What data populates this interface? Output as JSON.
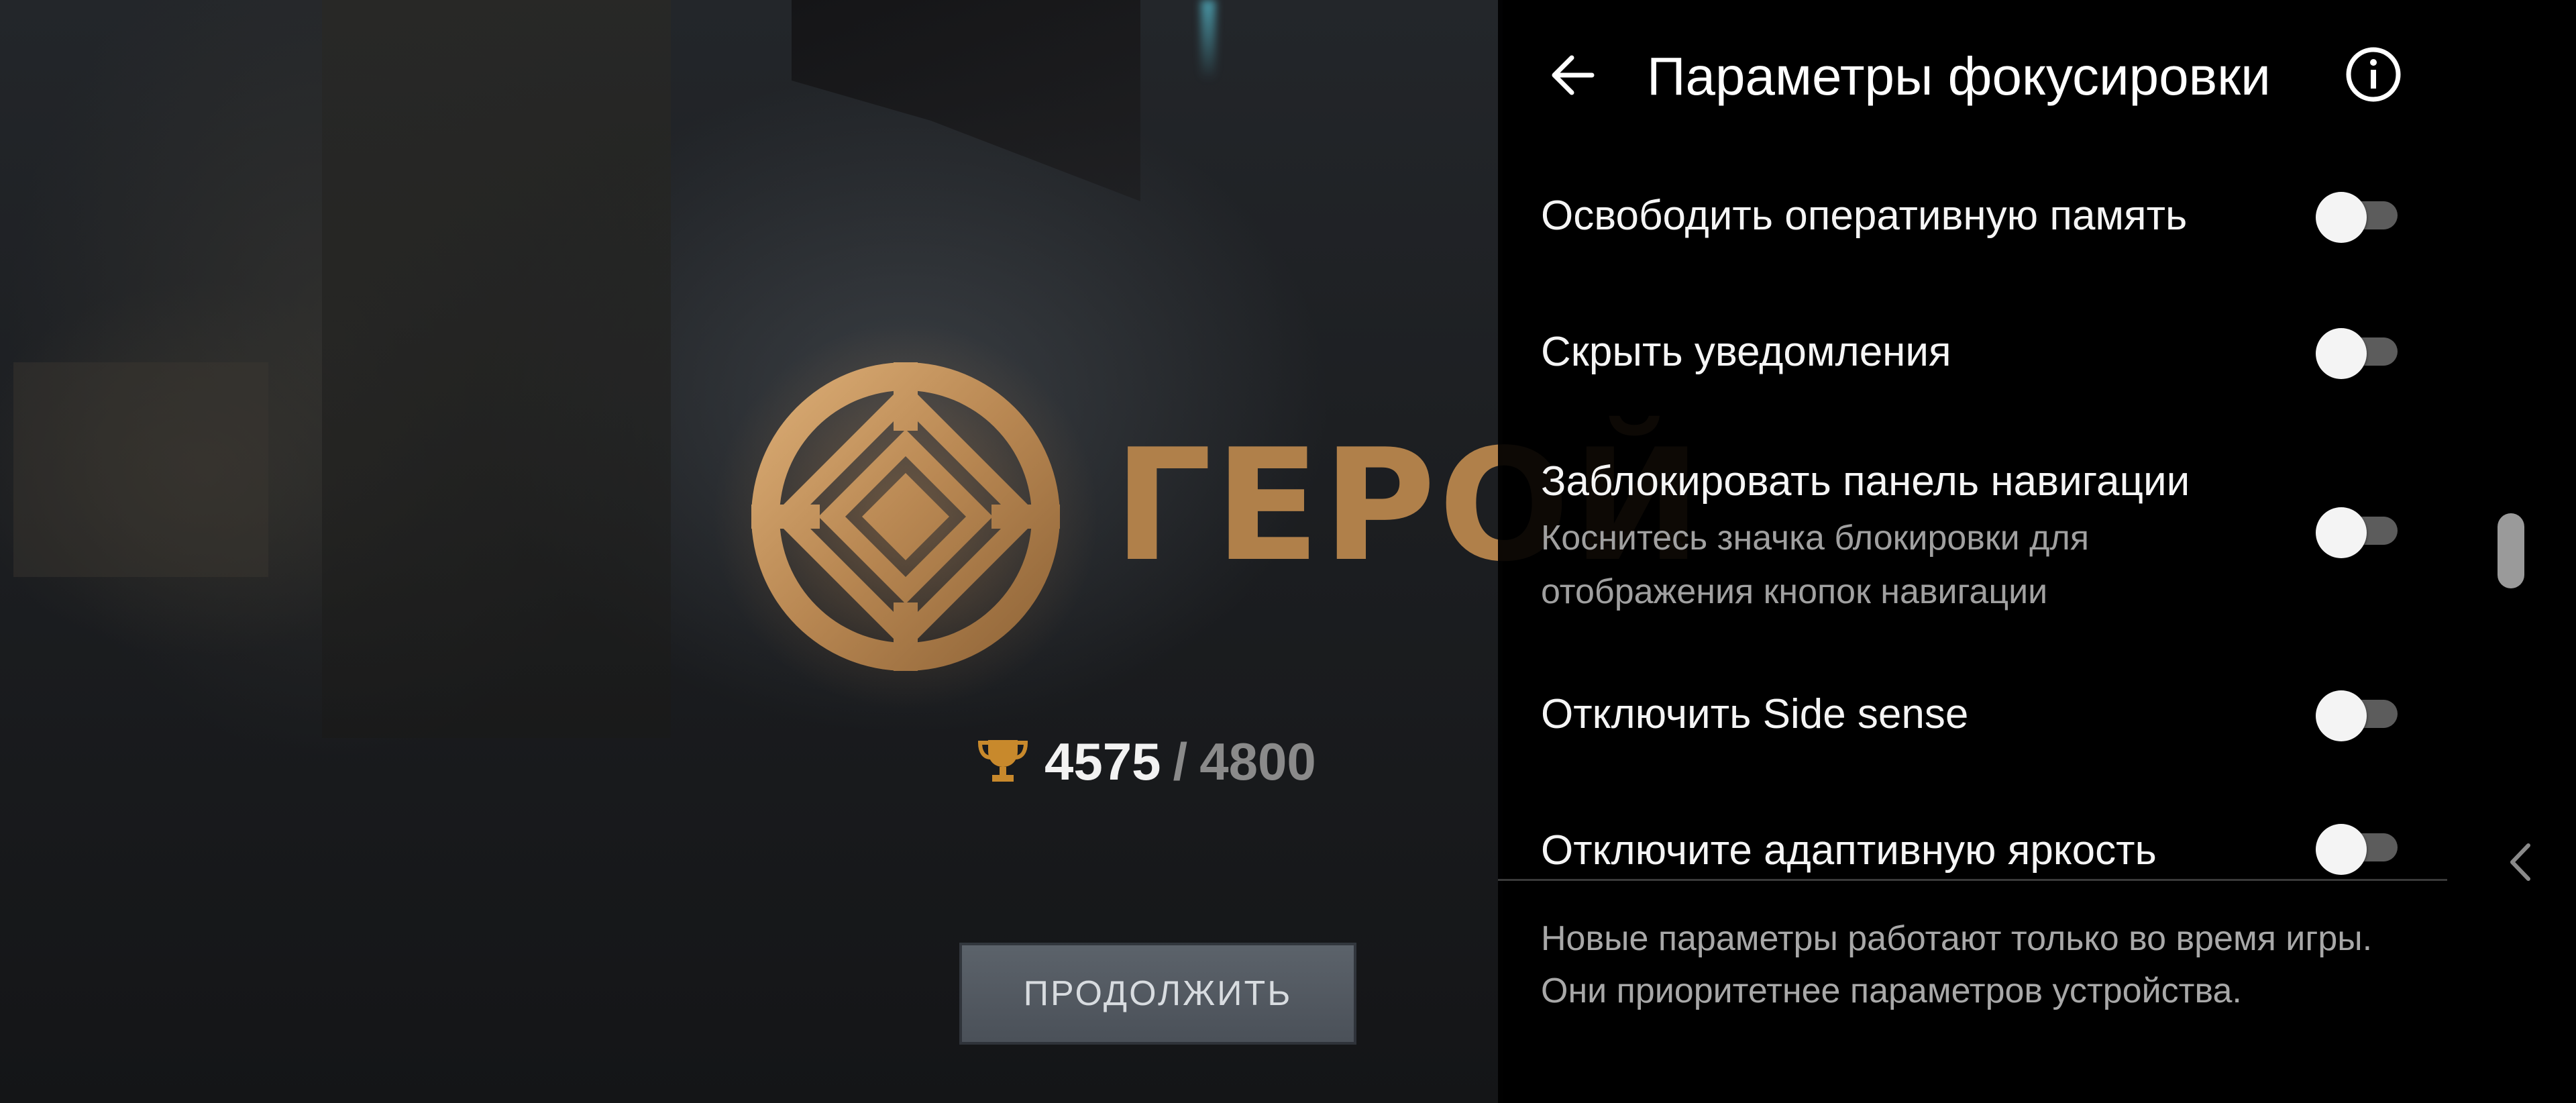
{
  "game": {
    "title": "ГЕРОЙ",
    "score_current": "4575",
    "score_separator": "/",
    "score_max": "4800",
    "continue_label": "ПРОДОЛЖИТЬ",
    "accent_color": "#b0804a"
  },
  "panel": {
    "title": "Параметры фокусировки",
    "back_icon": "back-arrow-icon",
    "info_icon": "info-icon",
    "settings": [
      {
        "label": "Освободить оперативную память",
        "description": "",
        "enabled": false
      },
      {
        "label": "Скрыть уведомления",
        "description": "",
        "enabled": false
      },
      {
        "label": "Заблокировать панель навигации",
        "description": "Коснитесь значка блокировки для отображения кнопок навигации",
        "enabled": false
      },
      {
        "label": "Отключить Side sense",
        "description": "",
        "enabled": false
      },
      {
        "label": "Отключите адаптивную яркость",
        "description": "",
        "enabled": false
      }
    ],
    "footer_line1": "Новые параметры работают только во время игры.",
    "footer_line2": "Они приоритетнее параметров устройства."
  }
}
